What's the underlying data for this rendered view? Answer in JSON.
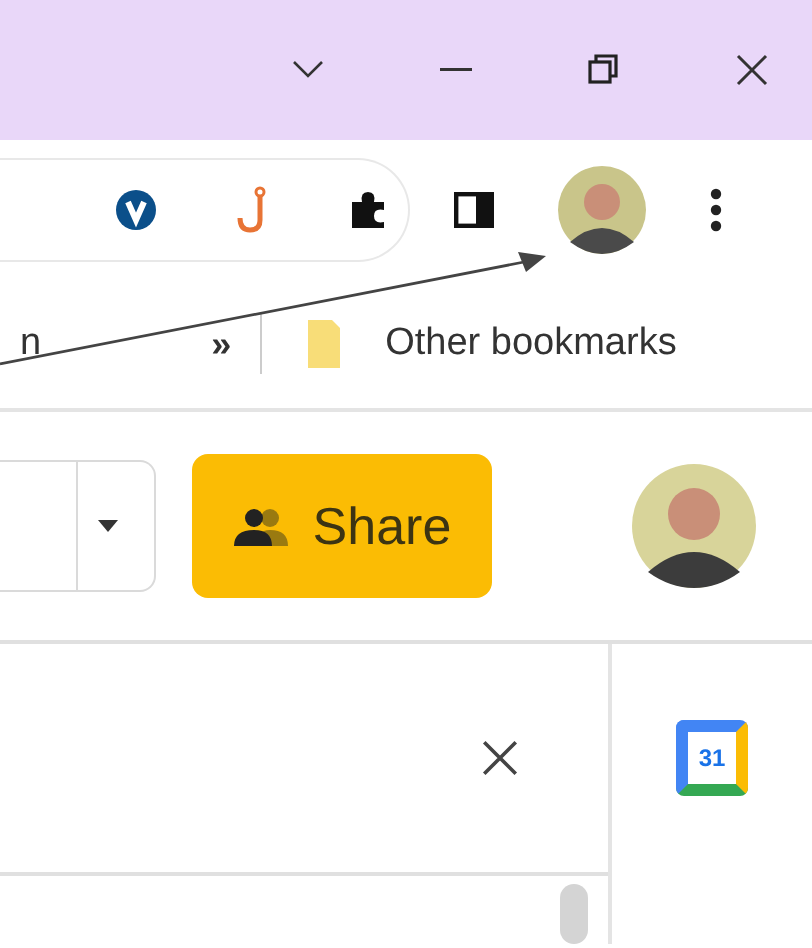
{
  "bookmarks_bar": {
    "items": [
      {
        "label": "n"
      }
    ],
    "overflow": "»",
    "other": "Other bookmarks"
  },
  "docs_header": {
    "share_button": "Share"
  },
  "side_panel": {
    "calendar_day": "31"
  }
}
